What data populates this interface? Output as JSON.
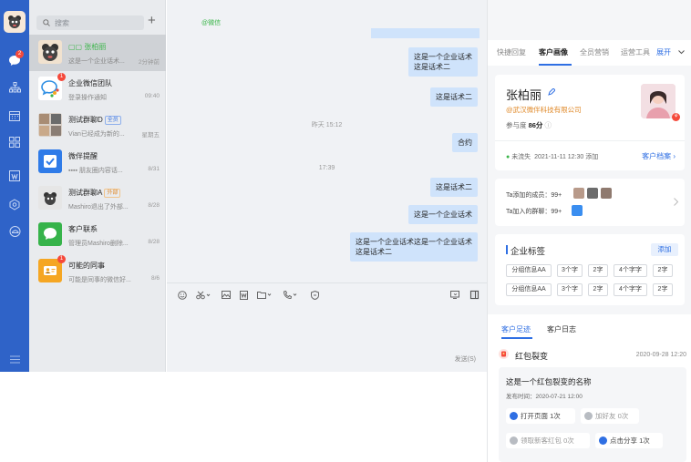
{
  "colors": {
    "accent": "#2f63c8",
    "bubble": "#cfe3fb",
    "badge": "#f5493b"
  },
  "sidebar": {
    "chat_badge": "2",
    "icons": [
      "chat-icon",
      "org-icon",
      "calendar-icon",
      "apps-icon",
      "doc-icon",
      "cube-icon",
      "cloud-icon",
      "menu-icon"
    ]
  },
  "conversations": {
    "search_placeholder": "搜索",
    "items": [
      {
        "name": "▢▢ 张柏丽",
        "sub": "这是一个企业话术...",
        "time": "2分钟前"
      },
      {
        "name": "企业微信团队",
        "sub": "登录操作通知",
        "time": "09:40",
        "badge": "1"
      },
      {
        "name": "测试群聊D",
        "tag": "全员",
        "sub": "Vian已经成为新的...",
        "time": "星期五"
      },
      {
        "name": "微伴提醒",
        "sub": "▪▪▪▪ 朋友圈内容话...",
        "time": "8/31"
      },
      {
        "name": "测试群聊A",
        "tag": "外部",
        "sub": "Mashiro退出了外部...",
        "time": "8/28"
      },
      {
        "name": "客户联系",
        "sub": "管理员Mashiro删除...",
        "time": "8/28"
      },
      {
        "name": "可能的同事",
        "sub": "可能是同事的微信好...",
        "time": "8/6",
        "badge": "1"
      }
    ]
  },
  "chat": {
    "title": "@微信",
    "messages": [
      {
        "text": "这是一个企业话术\n这是话术二"
      },
      {
        "text": "这是话术二"
      },
      {
        "time": "昨天 15:12"
      },
      {
        "text": "合约"
      },
      {
        "time": "17:39"
      },
      {
        "text": "这是话术二"
      },
      {
        "text": "这是一个企业话术"
      },
      {
        "text": "这是一个企业话术这是一个企业话术\n这是话术二"
      }
    ],
    "send_label": "发送(S)"
  },
  "panel": {
    "tabs": [
      "快捷回复",
      "客户画像",
      "全员营销",
      "运营工具"
    ],
    "expand": "展开",
    "customer": {
      "name": "张柏丽",
      "company": "@武汉微伴科技有限公司",
      "score_label": "参与度",
      "score": "86分",
      "status": "未流失",
      "added": "2021-11-11 12:30 添加",
      "file_link": "客户档案"
    },
    "relations": {
      "added_by": "Ta添加的成员：99+",
      "groups": "Ta加入的群聊：99+"
    },
    "tags": {
      "title": "企业标签",
      "add": "添加",
      "chips": [
        "分组信息AA",
        "3个字",
        "2字",
        "4个字字",
        "2字",
        "分组信息AA",
        "3个字",
        "2字",
        "4个字字",
        "2字"
      ]
    },
    "trace": {
      "tabs": [
        "客户足迹",
        "客户日志"
      ],
      "event": {
        "title": "红包裂变",
        "time": "2020-09-28 12:20",
        "name": "这是一个红包裂变的名称",
        "publish": "发布时间：2020-07-21 12:00"
      },
      "actions": [
        {
          "label": "打开页面",
          "count": "1次"
        },
        {
          "label": "加好友",
          "count": "0次"
        },
        {
          "label": "领取新客红包",
          "count": "0次"
        },
        {
          "label": "点击分享",
          "count": "1次"
        }
      ]
    }
  }
}
